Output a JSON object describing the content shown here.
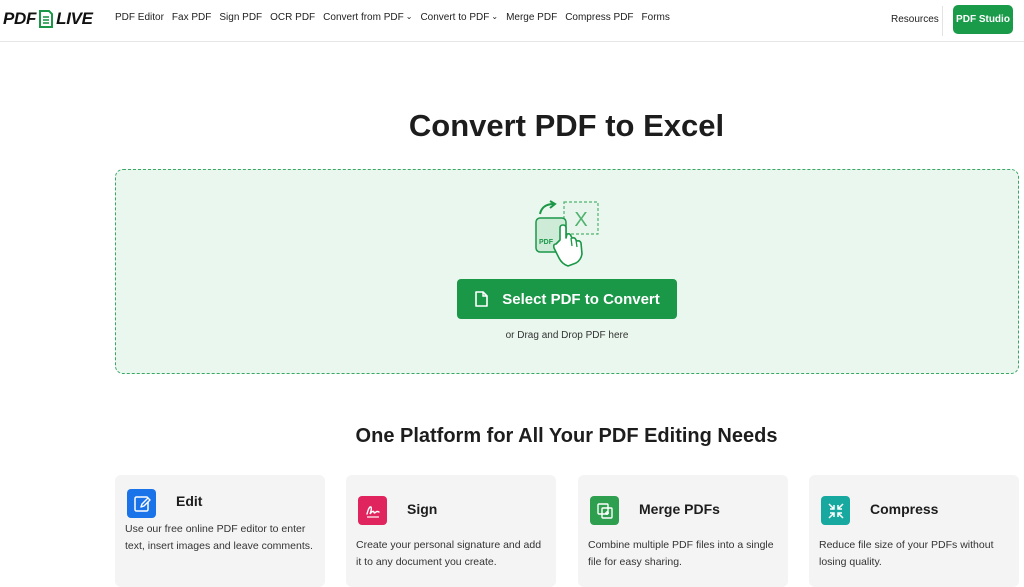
{
  "header": {
    "logo_left": "PDF",
    "logo_right": "LIVE",
    "nav": [
      {
        "label": "PDF Editor",
        "has_dropdown": false
      },
      {
        "label": "Fax PDF",
        "has_dropdown": false
      },
      {
        "label": "Sign PDF",
        "has_dropdown": false
      },
      {
        "label": "OCR PDF",
        "has_dropdown": false
      },
      {
        "label": "Convert from PDF",
        "has_dropdown": true
      },
      {
        "label": "Convert to PDF",
        "has_dropdown": true
      },
      {
        "label": "Merge PDF",
        "has_dropdown": false
      },
      {
        "label": "Compress PDF",
        "has_dropdown": false
      },
      {
        "label": "Forms",
        "has_dropdown": false
      }
    ],
    "resources_label": "Resources",
    "studio_button_label": "PDF Studio"
  },
  "main": {
    "title": "Convert PDF to Excel",
    "dropzone": {
      "illustration": "pdf-to-excel-icon",
      "illustration_pdf_label": "PDF",
      "illustration_x_label": "X",
      "select_button_label": "Select PDF to Convert",
      "drag_text": "or Drag and Drop PDF here"
    },
    "section_title": "One Platform for All Your PDF Editing Needs",
    "cards": [
      {
        "title": "Edit",
        "icon": "edit-icon",
        "icon_color": "#1a73e8",
        "description": "Use our free online PDF editor to enter text, insert images and leave comments."
      },
      {
        "title": "Sign",
        "icon": "signature-icon",
        "icon_color": "#e0245e",
        "description": "Create your personal signature and add it to any document you create."
      },
      {
        "title": "Merge PDFs",
        "icon": "merge-icon",
        "icon_color": "#2e9e4f",
        "description": "Combine multiple PDF files into a single file for easy sharing."
      },
      {
        "title": "Compress",
        "icon": "compress-icon",
        "icon_color": "#17a8a0",
        "description": "Reduce file size of your PDFs without losing quality."
      }
    ]
  },
  "colors": {
    "brand_green": "#1b9748",
    "dropzone_bg": "#eaf7ee",
    "dropzone_border": "#3aa765"
  }
}
